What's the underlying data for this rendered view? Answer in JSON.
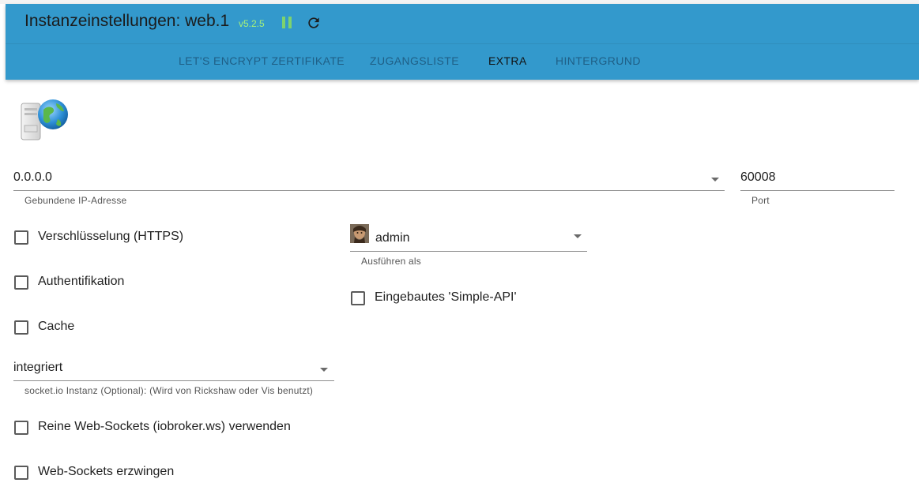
{
  "header": {
    "title": "Instanzeinstellungen: web.1",
    "version": "v5.2.5",
    "colors": {
      "appbar": "#3399cc",
      "version": "#a5f07a",
      "pause": "#7ed36e"
    },
    "icons": {
      "pause": "pause-icon",
      "reload": "reload-icon"
    }
  },
  "tabs": [
    {
      "label": "LET'S ENCRYPT ZERTIFIKATE",
      "active": false
    },
    {
      "label": "ZUGANGSLISTE",
      "active": false
    },
    {
      "label": "EXTRA",
      "active": true
    },
    {
      "label": "HINTERGRUND",
      "active": false
    }
  ],
  "form": {
    "ip": {
      "value": "0.0.0.0",
      "label": "Gebundene IP-Adresse"
    },
    "port": {
      "value": "60008",
      "label": "Port"
    },
    "https": {
      "label": "Verschlüsselung (HTTPS)",
      "checked": false
    },
    "run_as": {
      "value": "admin",
      "label": "Ausführen als",
      "icon": "user-avatar-icon"
    },
    "auth": {
      "label": "Authentifikation",
      "checked": false
    },
    "simple_api": {
      "label": "Eingebautes 'Simple-API'",
      "checked": false
    },
    "cache": {
      "label": "Cache",
      "checked": false
    },
    "socketio": {
      "value": "integriert",
      "label": "socket.io Instanz (Optional): (Wird von Rickshaw oder Vis benutzt)"
    },
    "pure_ws": {
      "label": "Reine Web-Sockets (iobroker.ws) verwenden",
      "checked": false
    },
    "force_ws": {
      "label": "Web-Sockets erzwingen",
      "checked": false
    }
  }
}
